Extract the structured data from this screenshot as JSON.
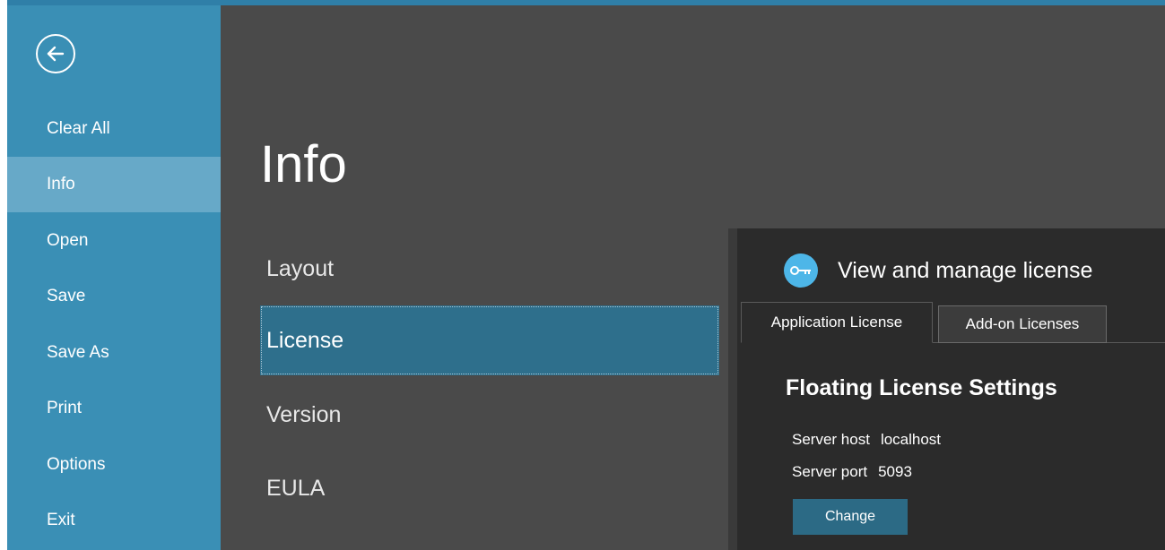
{
  "nav": {
    "back_icon": "back-arrow-icon",
    "items": [
      {
        "label": "Clear All",
        "active": false
      },
      {
        "label": "Info",
        "active": true
      },
      {
        "label": "Open",
        "active": false
      },
      {
        "label": "Save",
        "active": false
      },
      {
        "label": "Save As",
        "active": false
      },
      {
        "label": "Print",
        "active": false
      },
      {
        "label": "Options",
        "active": false
      },
      {
        "label": "Exit",
        "active": false
      }
    ]
  },
  "main": {
    "title": "Info",
    "sections": [
      {
        "label": "Layout",
        "selected": false
      },
      {
        "label": "License",
        "selected": true
      },
      {
        "label": "Version",
        "selected": false
      },
      {
        "label": "EULA",
        "selected": false
      }
    ]
  },
  "panel": {
    "icon": "key-icon",
    "title": "View and manage license",
    "tabs": [
      {
        "label": "Application License",
        "active": true
      },
      {
        "label": "Add-on Licenses",
        "active": false
      }
    ],
    "section_title": "Floating License Settings",
    "fields": {
      "server_host": {
        "label": "Server host",
        "value": "localhost"
      },
      "server_port": {
        "label": "Server port",
        "value": "5093"
      }
    },
    "change_button": "Change"
  },
  "colors": {
    "nav_bg": "#3a8fb5",
    "nav_active": "#67a9c8",
    "main_bg": "#4a4a4a",
    "selected_section": "#2e6f8c",
    "panel_bg": "#2b2b2b",
    "key_icon": "#4db6e8",
    "button_bg": "#2c6a85"
  }
}
